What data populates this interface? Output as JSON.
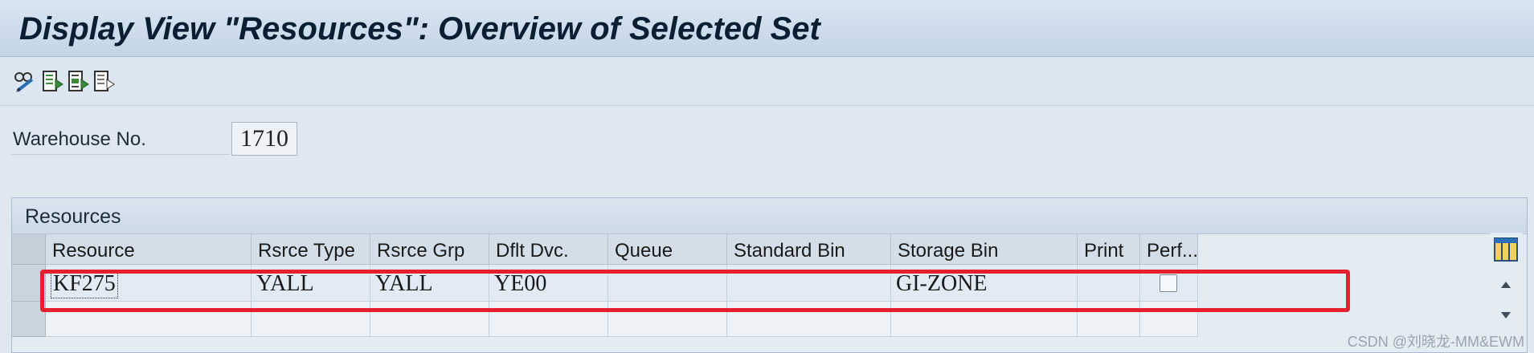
{
  "window": {
    "title": "Display View \"Resources\": Overview of Selected Set"
  },
  "toolbar": {
    "icons": [
      "display-change-icon",
      "select-all-icon",
      "select-block-icon",
      "deselect-all-icon"
    ]
  },
  "warehouse": {
    "label": "Warehouse No.",
    "value": "1710"
  },
  "resources": {
    "section_title": "Resources",
    "columns": [
      "Resource",
      "Rsrce Type",
      "Rsrce Grp",
      "Dflt Dvc.",
      "Queue",
      "Standard Bin",
      "Storage Bin",
      "Print",
      "Perf..."
    ],
    "rows": [
      {
        "resource": "KF275",
        "rsrce_type": "YALL",
        "rsrce_grp": "YALL",
        "dflt_dvc": "YE00",
        "queue": "",
        "standard_bin": "",
        "storage_bin": "GI-ZONE",
        "print": "",
        "perf_checked": false
      },
      {
        "resource": "",
        "rsrce_type": "",
        "rsrce_grp": "",
        "dflt_dvc": "",
        "queue": "",
        "standard_bin": "",
        "storage_bin": "",
        "print": "",
        "perf_checked": false
      }
    ]
  },
  "watermark": "CSDN @刘晓龙-MM&EWM",
  "colors": {
    "highlight": "#e5202e",
    "title_text": "#0b1f33"
  }
}
